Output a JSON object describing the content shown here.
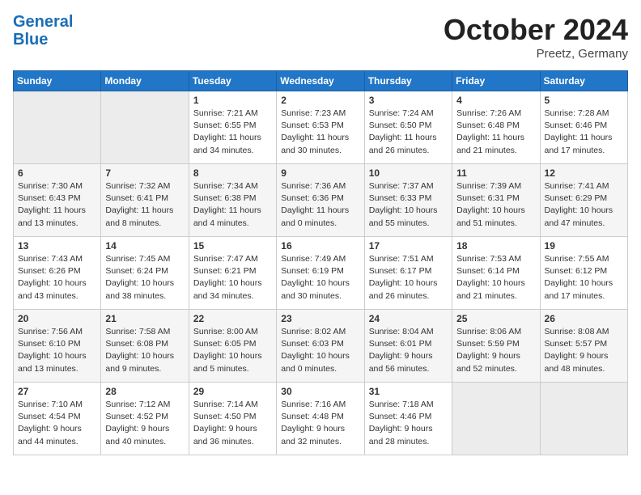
{
  "header": {
    "logo_line1": "General",
    "logo_line2": "Blue",
    "month": "October 2024",
    "location": "Preetz, Germany"
  },
  "days_of_week": [
    "Sunday",
    "Monday",
    "Tuesday",
    "Wednesday",
    "Thursday",
    "Friday",
    "Saturday"
  ],
  "weeks": [
    [
      {
        "day": "",
        "info": ""
      },
      {
        "day": "",
        "info": ""
      },
      {
        "day": "1",
        "info": "Sunrise: 7:21 AM\nSunset: 6:55 PM\nDaylight: 11 hours\nand 34 minutes."
      },
      {
        "day": "2",
        "info": "Sunrise: 7:23 AM\nSunset: 6:53 PM\nDaylight: 11 hours\nand 30 minutes."
      },
      {
        "day": "3",
        "info": "Sunrise: 7:24 AM\nSunset: 6:50 PM\nDaylight: 11 hours\nand 26 minutes."
      },
      {
        "day": "4",
        "info": "Sunrise: 7:26 AM\nSunset: 6:48 PM\nDaylight: 11 hours\nand 21 minutes."
      },
      {
        "day": "5",
        "info": "Sunrise: 7:28 AM\nSunset: 6:46 PM\nDaylight: 11 hours\nand 17 minutes."
      }
    ],
    [
      {
        "day": "6",
        "info": "Sunrise: 7:30 AM\nSunset: 6:43 PM\nDaylight: 11 hours\nand 13 minutes."
      },
      {
        "day": "7",
        "info": "Sunrise: 7:32 AM\nSunset: 6:41 PM\nDaylight: 11 hours\nand 8 minutes."
      },
      {
        "day": "8",
        "info": "Sunrise: 7:34 AM\nSunset: 6:38 PM\nDaylight: 11 hours\nand 4 minutes."
      },
      {
        "day": "9",
        "info": "Sunrise: 7:36 AM\nSunset: 6:36 PM\nDaylight: 11 hours\nand 0 minutes."
      },
      {
        "day": "10",
        "info": "Sunrise: 7:37 AM\nSunset: 6:33 PM\nDaylight: 10 hours\nand 55 minutes."
      },
      {
        "day": "11",
        "info": "Sunrise: 7:39 AM\nSunset: 6:31 PM\nDaylight: 10 hours\nand 51 minutes."
      },
      {
        "day": "12",
        "info": "Sunrise: 7:41 AM\nSunset: 6:29 PM\nDaylight: 10 hours\nand 47 minutes."
      }
    ],
    [
      {
        "day": "13",
        "info": "Sunrise: 7:43 AM\nSunset: 6:26 PM\nDaylight: 10 hours\nand 43 minutes."
      },
      {
        "day": "14",
        "info": "Sunrise: 7:45 AM\nSunset: 6:24 PM\nDaylight: 10 hours\nand 38 minutes."
      },
      {
        "day": "15",
        "info": "Sunrise: 7:47 AM\nSunset: 6:21 PM\nDaylight: 10 hours\nand 34 minutes."
      },
      {
        "day": "16",
        "info": "Sunrise: 7:49 AM\nSunset: 6:19 PM\nDaylight: 10 hours\nand 30 minutes."
      },
      {
        "day": "17",
        "info": "Sunrise: 7:51 AM\nSunset: 6:17 PM\nDaylight: 10 hours\nand 26 minutes."
      },
      {
        "day": "18",
        "info": "Sunrise: 7:53 AM\nSunset: 6:14 PM\nDaylight: 10 hours\nand 21 minutes."
      },
      {
        "day": "19",
        "info": "Sunrise: 7:55 AM\nSunset: 6:12 PM\nDaylight: 10 hours\nand 17 minutes."
      }
    ],
    [
      {
        "day": "20",
        "info": "Sunrise: 7:56 AM\nSunset: 6:10 PM\nDaylight: 10 hours\nand 13 minutes."
      },
      {
        "day": "21",
        "info": "Sunrise: 7:58 AM\nSunset: 6:08 PM\nDaylight: 10 hours\nand 9 minutes."
      },
      {
        "day": "22",
        "info": "Sunrise: 8:00 AM\nSunset: 6:05 PM\nDaylight: 10 hours\nand 5 minutes."
      },
      {
        "day": "23",
        "info": "Sunrise: 8:02 AM\nSunset: 6:03 PM\nDaylight: 10 hours\nand 0 minutes."
      },
      {
        "day": "24",
        "info": "Sunrise: 8:04 AM\nSunset: 6:01 PM\nDaylight: 9 hours\nand 56 minutes."
      },
      {
        "day": "25",
        "info": "Sunrise: 8:06 AM\nSunset: 5:59 PM\nDaylight: 9 hours\nand 52 minutes."
      },
      {
        "day": "26",
        "info": "Sunrise: 8:08 AM\nSunset: 5:57 PM\nDaylight: 9 hours\nand 48 minutes."
      }
    ],
    [
      {
        "day": "27",
        "info": "Sunrise: 7:10 AM\nSunset: 4:54 PM\nDaylight: 9 hours\nand 44 minutes."
      },
      {
        "day": "28",
        "info": "Sunrise: 7:12 AM\nSunset: 4:52 PM\nDaylight: 9 hours\nand 40 minutes."
      },
      {
        "day": "29",
        "info": "Sunrise: 7:14 AM\nSunset: 4:50 PM\nDaylight: 9 hours\nand 36 minutes."
      },
      {
        "day": "30",
        "info": "Sunrise: 7:16 AM\nSunset: 4:48 PM\nDaylight: 9 hours\nand 32 minutes."
      },
      {
        "day": "31",
        "info": "Sunrise: 7:18 AM\nSunset: 4:46 PM\nDaylight: 9 hours\nand 28 minutes."
      },
      {
        "day": "",
        "info": ""
      },
      {
        "day": "",
        "info": ""
      }
    ]
  ]
}
